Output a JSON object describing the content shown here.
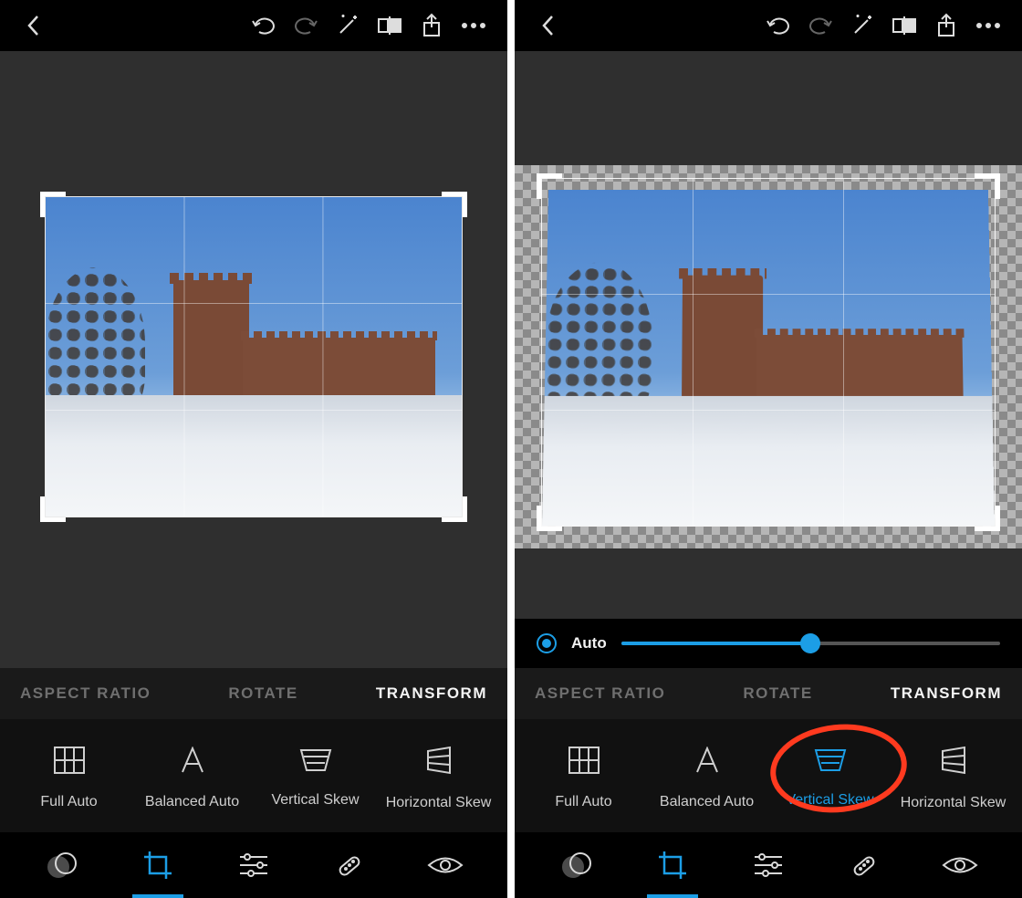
{
  "top_icons": {
    "back": "back-icon",
    "undo": "undo-icon",
    "redo": "redo-icon",
    "magic": "magic-wand-icon",
    "compare": "compare-icon",
    "share": "share-icon",
    "more": "more-icon"
  },
  "slider": {
    "label": "Auto",
    "value_percent": 50
  },
  "modes": {
    "aspect_ratio": "ASPECT RATIO",
    "rotate": "ROTATE",
    "transform": "TRANSFORM",
    "active": "transform"
  },
  "transform_options": {
    "full_auto": "Full Auto",
    "balanced_auto": "Balanced Auto",
    "vertical_skew": "Vertical Skew",
    "horizontal_skew": "Horizontal Skew"
  },
  "left_pane": {
    "selected_option": null
  },
  "right_pane": {
    "selected_option": "vertical_skew",
    "annotation": "red-circle"
  },
  "bottom_tabs": {
    "looks": "looks-icon",
    "crop": "crop-icon",
    "adjust": "sliders-icon",
    "heal": "heal-icon",
    "redeye": "eye-icon",
    "active": "crop"
  },
  "colors": {
    "accent": "#1c9ee6",
    "annotation": "#ff3a1f"
  }
}
